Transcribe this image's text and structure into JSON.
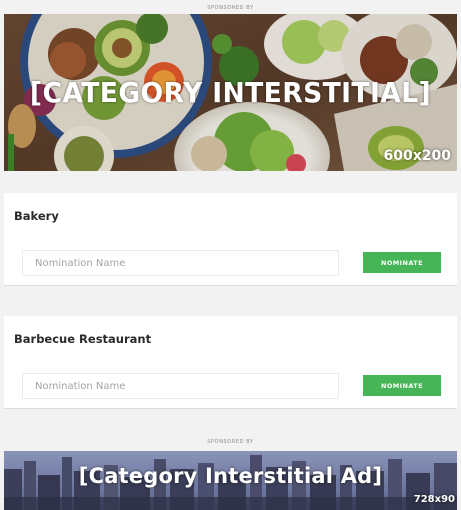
{
  "sponsored_top": "SPONSORED BY",
  "banner_top": {
    "title": "[CATEGORY INTERSTITIAL]",
    "size": "600x200"
  },
  "categories": [
    {
      "title": "Bakery",
      "input_placeholder": "Nomination Name",
      "input_value": "",
      "button_label": "NOMINATE"
    },
    {
      "title": "Barbecue Restaurant",
      "input_placeholder": "Nomination Name",
      "input_value": "",
      "button_label": "NOMINATE"
    }
  ],
  "sponsored_bottom": "SPONSORED BY",
  "banner_bottom": {
    "title": "[Category Interstitial Ad]",
    "size": "728x90"
  },
  "colors": {
    "page_background": "#f2f2f2",
    "card_background": "#ffffff",
    "button_green": "#45b557",
    "title_text": "#2a2a2a",
    "placeholder_text": "#a3a3a3"
  }
}
